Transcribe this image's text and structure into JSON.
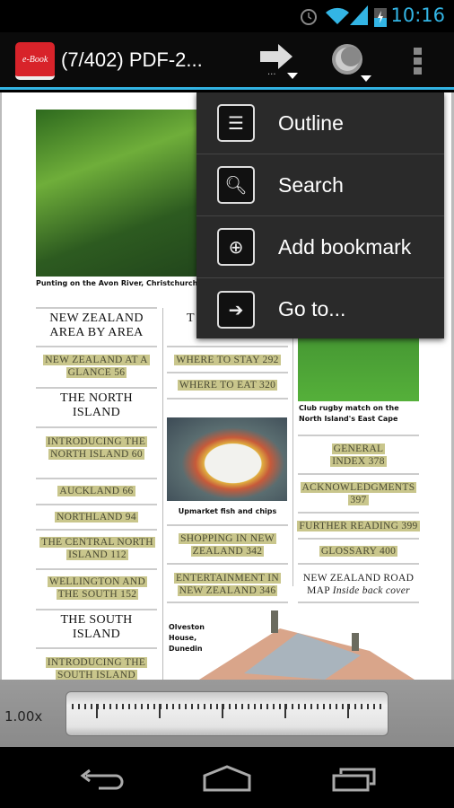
{
  "status_bar": {
    "time": "10:16",
    "icons": [
      "alarm-icon",
      "wifi-icon",
      "signal-icon",
      "battery-charging-icon"
    ]
  },
  "action_bar": {
    "app_icon_text": "e-Book",
    "title": "(7/402) PDF-2...",
    "actions": [
      "goto-arrow-icon",
      "night-mode-icon",
      "overflow-menu-icon"
    ]
  },
  "menu": {
    "items": [
      {
        "label": "Outline",
        "icon": "outline-list-icon"
      },
      {
        "label": "Search",
        "icon": "search-icon"
      },
      {
        "label": "Add bookmark",
        "icon": "bookmark-add-icon"
      },
      {
        "label": "Go to...",
        "icon": "goto-arrow-icon"
      }
    ]
  },
  "pdf": {
    "top_caption": "Punting on the Avon River, Christchurch",
    "col1": [
      "NEW ZEALAND AREA BY AREA",
      "NEW ZEALAND AT A GLANCE 56",
      "THE NORTH ISLAND",
      "INTRODUCING THE NORTH ISLAND 60",
      "AUCKLAND 66",
      "NORTHLAND 94",
      "THE CENTRAL NORTH ISLAND 112",
      "WELLINGTON AND THE SOUTH 152",
      "THE SOUTH ISLAND",
      "INTRODUCING THE SOUTH ISLAND"
    ],
    "col2": [
      "T",
      "WHERE TO STAY 292",
      "WHERE TO EAT 320",
      "Upmarket fish and chips",
      "SHOPPING IN NEW ZEALAND 342",
      "ENTERTAINMENT IN NEW ZEALAND 346",
      "Olveston House, Dunedin"
    ],
    "col3": [
      "Club rugby match on the North Island's East Cape",
      "GENERAL INDEX 378",
      "ACKNOWLEDGMENTS 397",
      "FURTHER READING 399",
      "GLOSSARY 400",
      "NEW ZEALAND ROAD MAP",
      "Inside back cover"
    ]
  },
  "zoom": {
    "label": "1.00x",
    "value": 1.0
  },
  "nav": [
    "back-icon",
    "home-icon",
    "recents-icon"
  ]
}
